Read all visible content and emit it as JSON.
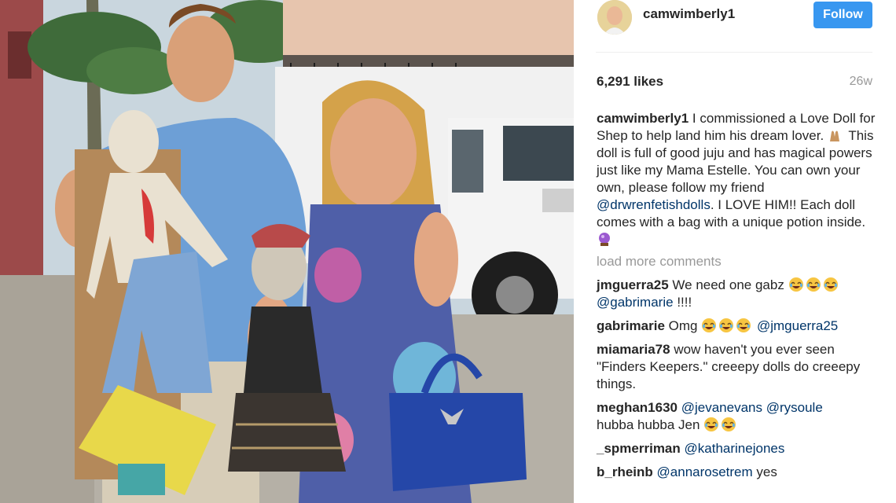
{
  "post": {
    "username": "camwimberly1",
    "follow_label": "Follow",
    "likes": "6,291 likes",
    "age": "26w"
  },
  "caption": {
    "user": "camwimberly1",
    "text_1": "I commissioned a Love Doll for Shep to help land him his dream lover.",
    "emoji_1": "raised-hands",
    "text_2": "This doll is full of good juju and has magical powers just like my Mama Estelle. You can own your own, please follow my friend",
    "mention": "@drwrenfetishdolls",
    "text_3": ". I LOVE HIM!! Each doll comes with a bag with a unique potion inside.",
    "emoji_2": "crystal-ball"
  },
  "load_more_label": "load more comments",
  "comments": [
    {
      "user": "jmguerra25",
      "text": "We need one gabz",
      "emojis": [
        "joy",
        "joy",
        "joy"
      ],
      "mention": "@gabrimarie",
      "tail": "!!!!"
    },
    {
      "user": "gabrimarie",
      "text": "Omg",
      "emojis": [
        "joy",
        "joy",
        "joy"
      ],
      "mention": "@jmguerra25",
      "tail": ""
    },
    {
      "user": "miamaria78",
      "text": "wow haven't you ever seen \"Finders Keepers.\" creeepy dolls do creeepy things."
    },
    {
      "user": "meghan1630",
      "mention": "@jevanevans",
      "mention2": "@rysoule",
      "text": "hubba hubba Jen",
      "emojis": [
        "joy",
        "joy"
      ]
    },
    {
      "user": "_spmerriman",
      "mention": "@katharinejones"
    },
    {
      "user": "b_rheinb",
      "mention": "@annarosetrem",
      "text": "yes"
    }
  ],
  "colors": {
    "follow_bg": "#3897f0",
    "mention": "#003569",
    "muted": "#999999"
  }
}
